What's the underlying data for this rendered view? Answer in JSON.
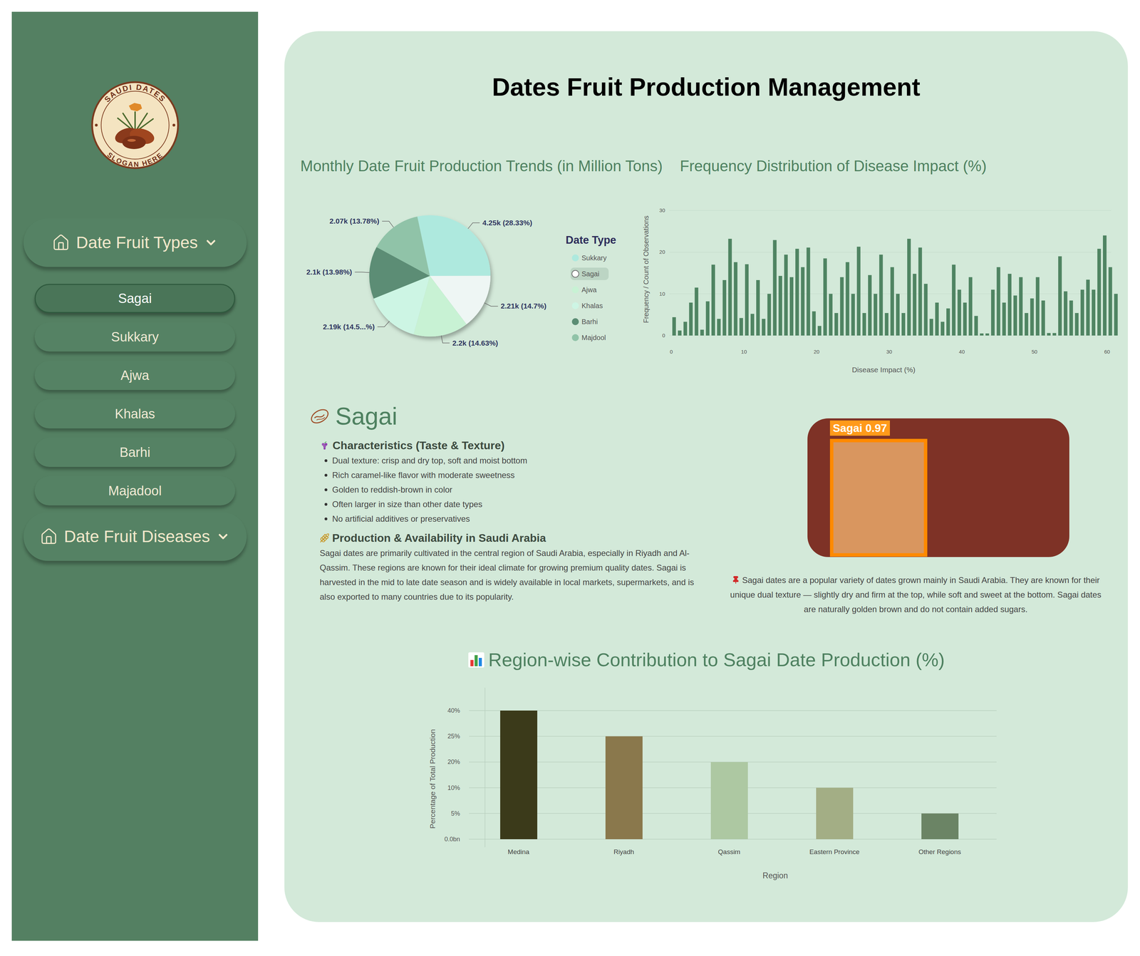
{
  "sidebar": {
    "logo": {
      "top_text": "SAUDI DATES",
      "bottom_text": "SLOGAN HERE"
    },
    "menus": [
      {
        "label": "Date Fruit Types",
        "items": [
          {
            "label": "Sagai",
            "selected": true
          },
          {
            "label": "Sukkary",
            "selected": false
          },
          {
            "label": "Ajwa",
            "selected": false
          },
          {
            "label": "Khalas",
            "selected": false
          },
          {
            "label": "Barhi",
            "selected": false
          },
          {
            "label": "Majadool",
            "selected": false
          }
        ]
      },
      {
        "label": "Date Fruit Diseases",
        "items": []
      }
    ]
  },
  "main": {
    "title": "Dates Fruit Production Management",
    "production_chart": {
      "title": "Monthly Date Fruit Production Trends (in Million Tons)",
      "legend_title": "Date Type",
      "slices": [
        {
          "name": "Sukkary",
          "value": 4.25,
          "label": "4.25k (28.33%)",
          "color": "#aee9de",
          "selected": false
        },
        {
          "name": "Sagai",
          "value": 2.21,
          "label": "2.21k (14.7%)",
          "color": "#eef6f4",
          "selected": true
        },
        {
          "name": "Ajwa",
          "value": 2.2,
          "label": "2.2k (14.63%)",
          "color": "#c8f2d4",
          "selected": false
        },
        {
          "name": "Khalas",
          "value": 2.19,
          "label": "2.19k (14.5...%)",
          "color": "#cdf5e4",
          "selected": false
        },
        {
          "name": "Barhi",
          "value": 2.1,
          "label": "2.1k (13.98%)",
          "color": "#5b8d74",
          "selected": false
        },
        {
          "name": "Majdool",
          "value": 2.07,
          "label": "2.07k (13.78%)",
          "color": "#90c3a8",
          "selected": false
        }
      ]
    },
    "disease_chart": {
      "title": "Frequency Distribution of Disease Impact (%)",
      "y_axis_title": "Frequency / Count of Observations",
      "x_axis_title": "Disease Impact (%)",
      "y_ticks": [
        "0",
        "10",
        "20",
        "30"
      ],
      "x_ticks": [
        "0",
        "10",
        "20",
        "30",
        "40",
        "50",
        "60"
      ],
      "values": [
        4.4,
        1.2,
        3.3,
        7.9,
        11.5,
        1.4,
        8.2,
        17,
        4,
        13.3,
        23.2,
        17.6,
        4.2,
        17.1,
        5.2,
        13.3,
        4,
        10,
        22.9,
        14.3,
        19.4,
        14,
        20.8,
        16.4,
        21.1,
        5.8,
        2.3,
        18.5,
        10,
        5.4,
        14,
        17.6,
        10,
        21.3,
        5.4,
        14.5,
        10,
        19.4,
        5.4,
        16.4,
        10,
        5.4,
        23.2,
        14.8,
        21.1,
        12.4,
        4,
        7.9,
        3.3,
        6.5,
        17,
        11,
        7.9,
        14,
        4.7,
        0.5,
        0.5,
        11,
        16.4,
        7.9,
        14.8,
        9.6,
        14,
        5.4,
        8.9,
        14,
        8.4,
        0.6,
        0.6,
        19,
        10.6,
        8.4,
        5.4,
        11,
        13.4,
        11,
        20.8,
        24,
        16.4,
        10
      ]
    },
    "variety": {
      "name": "Sagai",
      "characteristics_title": "Characteristics (Taste & Texture)",
      "characteristics": [
        "Dual texture: crisp and dry top, soft and moist bottom",
        "Rich caramel-like flavor with moderate sweetness",
        "Golden to reddish-brown in color",
        "Often larger in size than other date types",
        "No artificial additives or preservatives"
      ],
      "production_title": "Production & Availability in Saudi Arabia",
      "production_text": "Sagai dates are primarily cultivated in the central region of Saudi Arabia, especially in Riyadh and Al-Qassim. These regions are known for their ideal climate for growing premium quality dates. Sagai is harvested in the mid to late date season and is widely available in local markets, supermarkets, and is also exported to many countries due to its popularity.",
      "detection_label": "Sagai 0.97",
      "caption": "Sagai dates are a popular variety of dates grown mainly in Saudi Arabia. They are known for their unique dual texture — slightly dry and firm at the top, while soft and sweet at the bottom. Sagai dates are naturally golden brown and do not contain added sugars."
    },
    "region_chart": {
      "title": "Region-wise Contribution to Sagai Date Production (%)",
      "y_axis_title": "Percentage of Total Production",
      "x_axis_title": "Region",
      "y_ticks": [
        {
          "label": "0.0bn",
          "value": 0
        },
        {
          "label": "5%",
          "value": 5
        },
        {
          "label": "10%",
          "value": 10
        },
        {
          "label": "20%",
          "value": 20
        },
        {
          "label": "25%",
          "value": 25
        },
        {
          "label": "40%",
          "value": 40
        }
      ],
      "bars": [
        {
          "region": "Medina",
          "value": 40,
          "color": "#3b3a1a"
        },
        {
          "region": "Riyadh",
          "value": 25,
          "color": "#8a784c"
        },
        {
          "region": "Qassim",
          "value": 20,
          "color": "#adc8a2"
        },
        {
          "region": "Eastern Province",
          "value": 10,
          "color": "#a3ae85"
        },
        {
          "region": "Other Regions",
          "value": 5,
          "color": "#6b8465"
        }
      ]
    }
  }
}
